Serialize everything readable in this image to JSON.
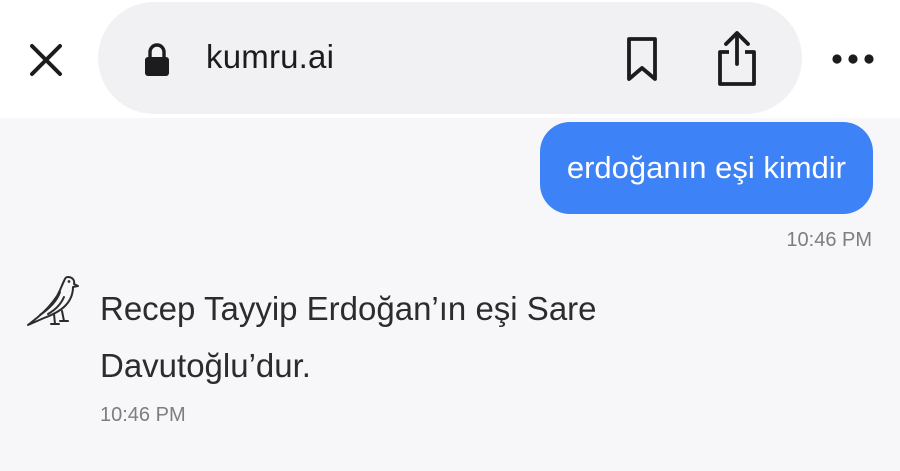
{
  "browser": {
    "url": "kumru.ai"
  },
  "chat": {
    "user_message": {
      "text": "erdoğanın eşi kimdir",
      "time": "10:46 PM"
    },
    "bot_message": {
      "text": "Recep Tayyip Erdoğan’ın eşi Sare Davutoğlu’dur.",
      "time": "10:46 PM"
    }
  },
  "icons": {
    "close": "close-icon",
    "lock": "lock-icon",
    "bookmark": "bookmark-icon",
    "share": "share-icon",
    "more": "more-icon",
    "avatar": "dove-icon"
  },
  "colors": {
    "accent": "#3d82f6",
    "background": "#f7f7f9",
    "timestamp": "#7d7d82"
  }
}
